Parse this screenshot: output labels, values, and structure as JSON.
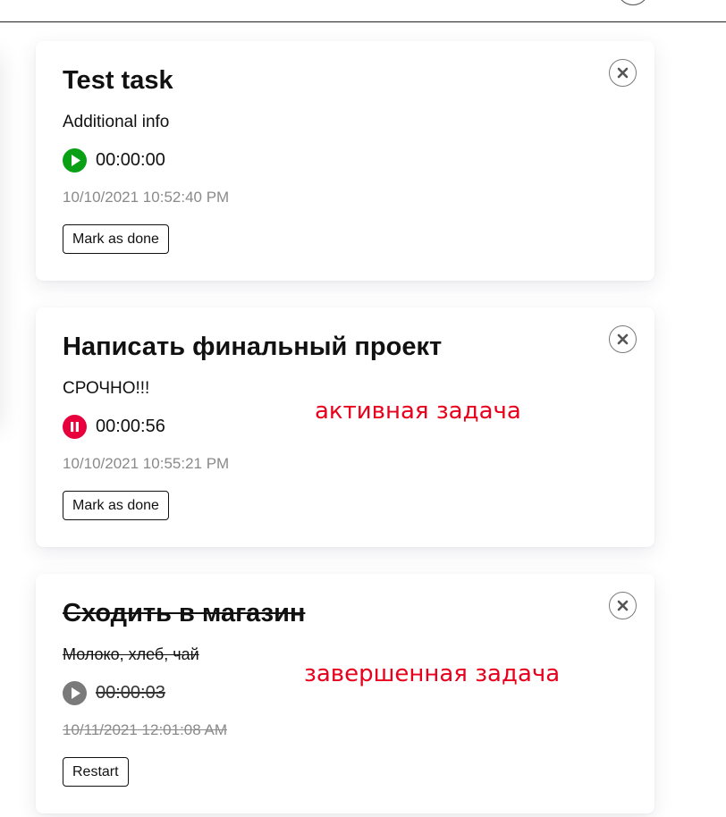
{
  "tasks": [
    {
      "title": "Test task",
      "description": "Additional info",
      "timer": "00:00:00",
      "timer_state": "play",
      "created": "10/10/2021 10:52:40 PM",
      "action_label": "Mark as done",
      "status": "pending"
    },
    {
      "title": "Написать финальный проект",
      "description": "СРОЧНО!!!",
      "timer": "00:00:56",
      "timer_state": "pause",
      "created": "10/10/2021 10:55:21 PM",
      "action_label": "Mark as done",
      "status": "active"
    },
    {
      "title": "Сходить в магазин",
      "description": "Молоко, хлеб, чай",
      "timer": "00:00:03",
      "timer_state": "play-disabled",
      "created": "10/11/2021 12:01:08 AM",
      "action_label": "Restart",
      "status": "done"
    }
  ],
  "annotations": {
    "active": "активная задача",
    "done": "завершенная задача"
  },
  "icons": {
    "play": "play-icon",
    "pause": "pause-icon",
    "close": "close-icon"
  },
  "colors": {
    "play": "#0aa015",
    "pause": "#e8003d",
    "play_disabled": "#7a7a7a",
    "annotation": "#e8001c",
    "date": "#8a8a8a"
  }
}
